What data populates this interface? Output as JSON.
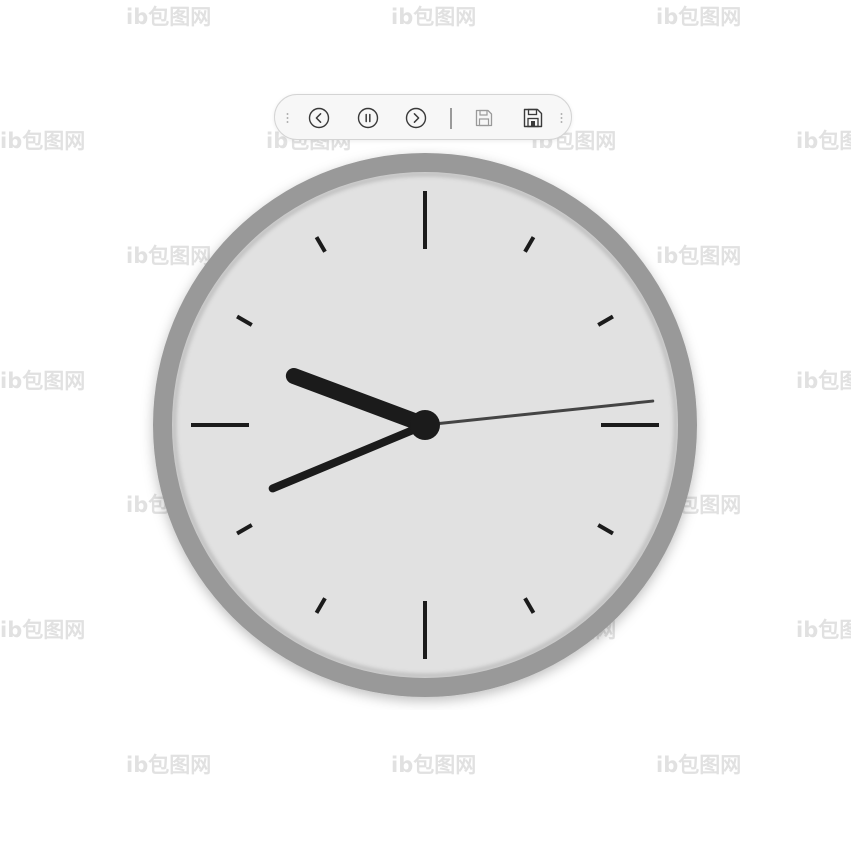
{
  "watermark": {
    "text": "ib包图网"
  },
  "toolbar": {
    "buttons": [
      {
        "name": "previous-button",
        "icon": "chevron-left-icon"
      },
      {
        "name": "pause-button",
        "icon": "pause-icon"
      },
      {
        "name": "next-button",
        "icon": "chevron-right-icon"
      },
      {
        "name": "save-button",
        "icon": "floppy-disk-icon"
      },
      {
        "name": "save-as-button",
        "icon": "floppy-disk-alt-icon"
      }
    ]
  },
  "clock": {
    "time": {
      "hours": 9,
      "minutes": 41,
      "seconds": 14
    },
    "colors": {
      "bezel": "#999999",
      "face": "#e1e1e1",
      "ticks": "#1b1b1b",
      "hands": "#1b1b1b",
      "second_hand": "#444444"
    }
  }
}
